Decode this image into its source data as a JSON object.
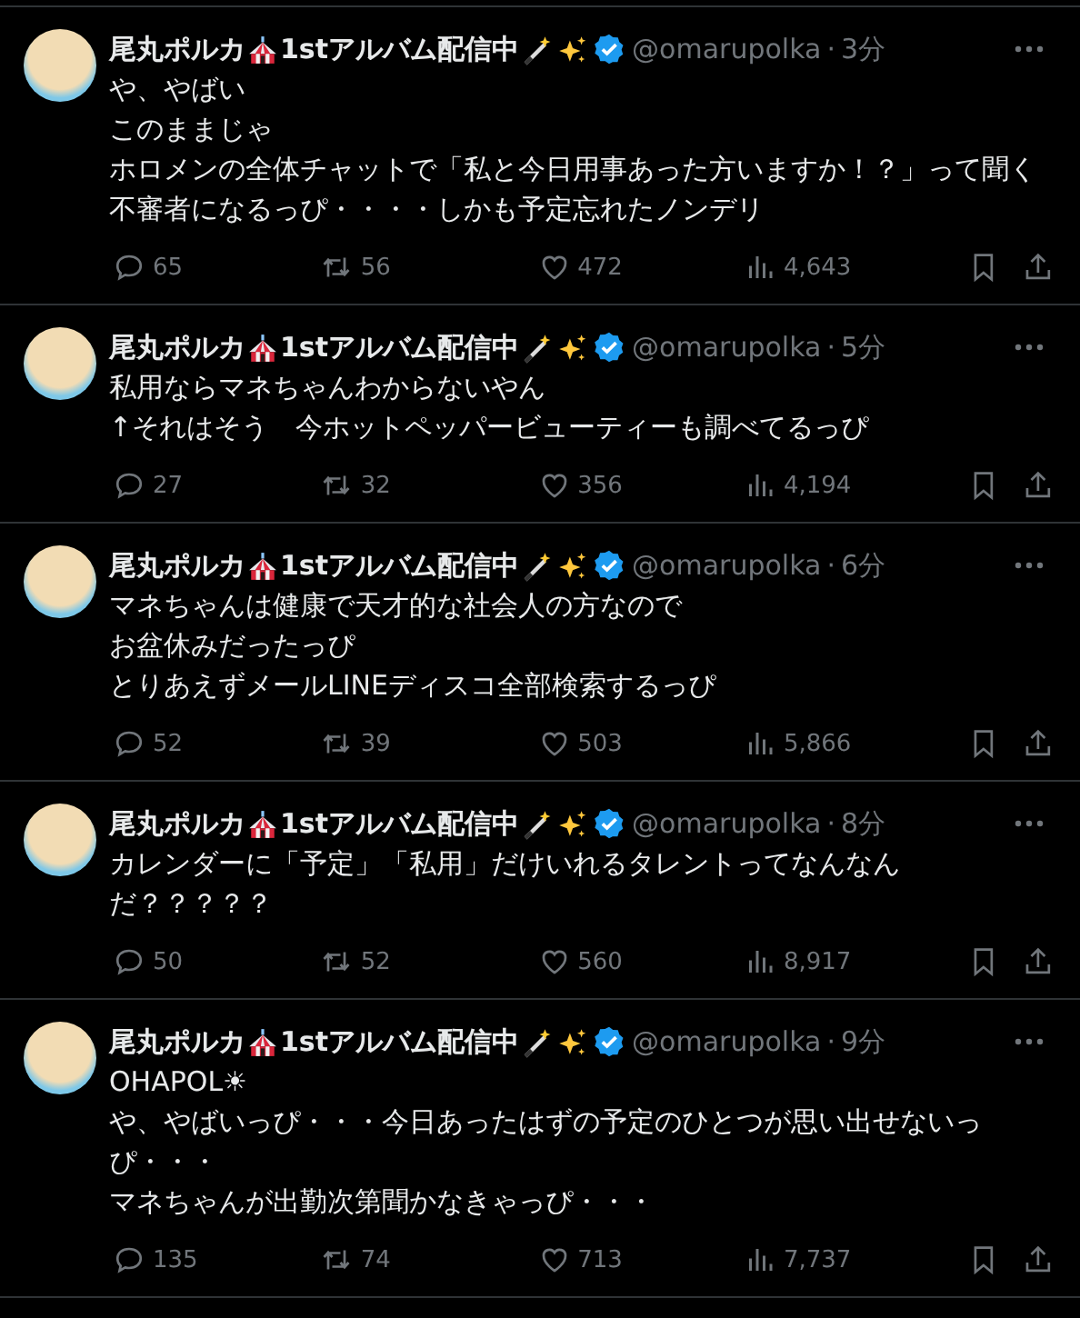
{
  "separator": "·",
  "tweets": [
    {
      "name": "尾丸ポルカ",
      "name_suffix": "1stアルバム配信中",
      "handle": "@omarupolka",
      "time": "3分",
      "lines": [
        "や、やばい",
        "このままじゃ",
        "ホロメンの全体チャットで「私と今日用事あった方いますか！？」って聞く不審者になるっぴ・・・・しかも予定忘れたノンデリ"
      ],
      "replies": "65",
      "reposts": "56",
      "likes": "472",
      "views": "4,643"
    },
    {
      "name": "尾丸ポルカ",
      "name_suffix": "1stアルバム配信中",
      "handle": "@omarupolka",
      "time": "5分",
      "lines": [
        "私用ならマネちゃんわからないやん",
        "↑それはそう　今ホットペッパービューティーも調べてるっぴ"
      ],
      "replies": "27",
      "reposts": "32",
      "likes": "356",
      "views": "4,194"
    },
    {
      "name": "尾丸ポルカ",
      "name_suffix": "1stアルバム配信中",
      "handle": "@omarupolka",
      "time": "6分",
      "lines": [
        "マネちゃんは健康で天才的な社会人の方なので",
        "お盆休みだったっぴ",
        "とりあえずメールLINEディスコ全部検索するっぴ"
      ],
      "replies": "52",
      "reposts": "39",
      "likes": "503",
      "views": "5,866"
    },
    {
      "name": "尾丸ポルカ",
      "name_suffix": "1stアルバム配信中",
      "handle": "@omarupolka",
      "time": "8分",
      "lines": [
        "カレンダーに「予定」「私用」だけいれるタレントってなんなんだ？？？？？"
      ],
      "replies": "50",
      "reposts": "52",
      "likes": "560",
      "views": "8,917"
    },
    {
      "name": "尾丸ポルカ",
      "name_suffix": "1stアルバム配信中",
      "handle": "@omarupolka",
      "time": "9分",
      "lines": [
        "OHAPOL☀",
        "や、やばいっぴ・・・今日あったはずの予定のひとつが思い出せないっぴ・・・",
        "マネちゃんが出勤次第聞かなきゃっぴ・・・"
      ],
      "replies": "135",
      "reposts": "74",
      "likes": "713",
      "views": "7,737"
    }
  ]
}
